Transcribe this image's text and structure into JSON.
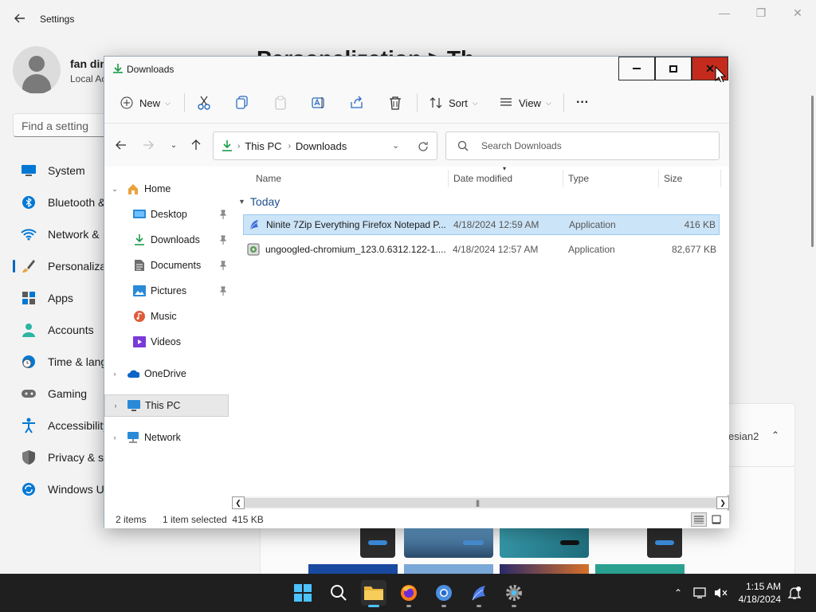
{
  "settings": {
    "title": "Settings",
    "user_name": "fan din",
    "user_sub": "Local Ac",
    "search_placeholder": "Find a setting",
    "page_heading": "Personalization > Th",
    "nav": [
      {
        "label": "System",
        "icon": "monitor-icon"
      },
      {
        "label": "Bluetooth &",
        "icon": "bluetooth-icon"
      },
      {
        "label": "Network &",
        "icon": "wifi-icon"
      },
      {
        "label": "Personaliza",
        "icon": "brush-icon"
      },
      {
        "label": "Apps",
        "icon": "apps-icon"
      },
      {
        "label": "Accounts",
        "icon": "person-icon"
      },
      {
        "label": "Time & lang",
        "icon": "clock-globe-icon"
      },
      {
        "label": "Gaming",
        "icon": "gamepad-icon"
      },
      {
        "label": "Accessibility",
        "icon": "accessibility-icon"
      },
      {
        "label": "Privacy & se",
        "icon": "shield-icon"
      },
      {
        "label": "Windows U",
        "icon": "update-icon"
      }
    ],
    "card_text": "esian2"
  },
  "explorer": {
    "title": "Downloads",
    "toolbar": {
      "new_label": "New",
      "sort_label": "Sort",
      "view_label": "View",
      "more_label": "···"
    },
    "address": {
      "crumbs": [
        "This PC",
        "Downloads"
      ]
    },
    "search_placeholder": "Search Downloads",
    "nav_pane": [
      {
        "label": "Home",
        "icon": "home-icon",
        "expander": "⌄",
        "pinned": false
      },
      {
        "label": "Desktop",
        "icon": "desktop-icon",
        "expander": "",
        "pinned": true
      },
      {
        "label": "Downloads",
        "icon": "download-icon",
        "expander": "",
        "pinned": true
      },
      {
        "label": "Documents",
        "icon": "documents-icon",
        "expander": "",
        "pinned": true
      },
      {
        "label": "Pictures",
        "icon": "pictures-icon",
        "expander": "",
        "pinned": true
      },
      {
        "label": "Music",
        "icon": "music-icon",
        "expander": "",
        "pinned": false
      },
      {
        "label": "Videos",
        "icon": "videos-icon",
        "expander": "",
        "pinned": false
      },
      {
        "label": "OneDrive",
        "icon": "onedrive-icon",
        "expander": "›",
        "pinned": false
      },
      {
        "label": "This PC",
        "icon": "this-pc-icon",
        "expander": "›",
        "pinned": false
      },
      {
        "label": "Network",
        "icon": "network-icon",
        "expander": "›",
        "pinned": false
      }
    ],
    "columns": [
      "Name",
      "Date modified",
      "Type",
      "Size"
    ],
    "group": "Today",
    "files": [
      {
        "name": "Ninite 7Zip Everything Firefox Notepad P...",
        "date": "4/18/2024 12:59 AM",
        "type": "Application",
        "size": "416 KB",
        "icon": "ninite-icon"
      },
      {
        "name": "ungoogled-chromium_123.0.6312.122-1....",
        "date": "4/18/2024 12:57 AM",
        "type": "Application",
        "size": "82,677 KB",
        "icon": "installer-icon"
      }
    ],
    "status": {
      "items": "2 items",
      "selected": "1 item selected  415 KB"
    }
  },
  "taskbar": {
    "apps": [
      {
        "name": "start-button",
        "icon": "windows-logo-icon"
      },
      {
        "name": "search-button",
        "icon": "search-icon"
      },
      {
        "name": "file-explorer-app",
        "icon": "folder-icon"
      },
      {
        "name": "firefox-app",
        "icon": "firefox-icon"
      },
      {
        "name": "chromium-app",
        "icon": "chromium-icon"
      },
      {
        "name": "ninite-app",
        "icon": "ninite-icon"
      },
      {
        "name": "settings-app",
        "icon": "gear-icon"
      }
    ],
    "clock": {
      "time": "1:15 AM",
      "date": "4/18/2024"
    }
  },
  "colors": {
    "accent": "#0067c0",
    "selection": "#cce4f7",
    "close_red": "#c42b1c",
    "taskbar": "#1f1f1f"
  }
}
